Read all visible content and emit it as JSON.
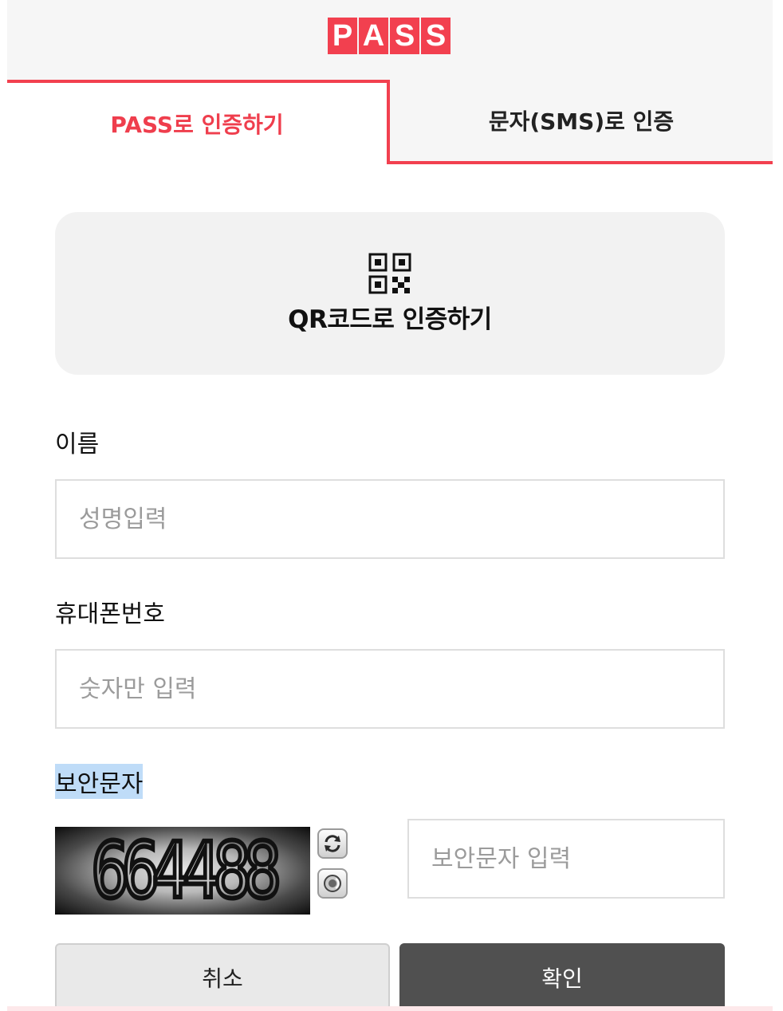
{
  "logo": {
    "letters": [
      "P",
      "A",
      "S",
      "S"
    ],
    "color": "#f2404f"
  },
  "tabs": [
    {
      "label": "PASS로 인증하기",
      "active": true
    },
    {
      "label": "문자(SMS)로 인증",
      "active": false
    }
  ],
  "qr": {
    "label": "QR코드로 인증하기",
    "icon": "qr-code-icon"
  },
  "form": {
    "name": {
      "label": "이름",
      "placeholder": "성명입력",
      "value": ""
    },
    "phone": {
      "label": "휴대폰번호",
      "placeholder": "숫자만 입력",
      "value": ""
    },
    "captcha": {
      "label": "보안문자",
      "image_text": "664488",
      "placeholder": "보안문자 입력",
      "value": "",
      "refresh_icon": "refresh-icon",
      "audio_icon": "speaker-icon"
    }
  },
  "buttons": {
    "cancel": "취소",
    "confirm": "확인"
  },
  "colors": {
    "accent": "#f2404f",
    "confirm_bg": "#505050",
    "selection": "#bfdcf8"
  }
}
